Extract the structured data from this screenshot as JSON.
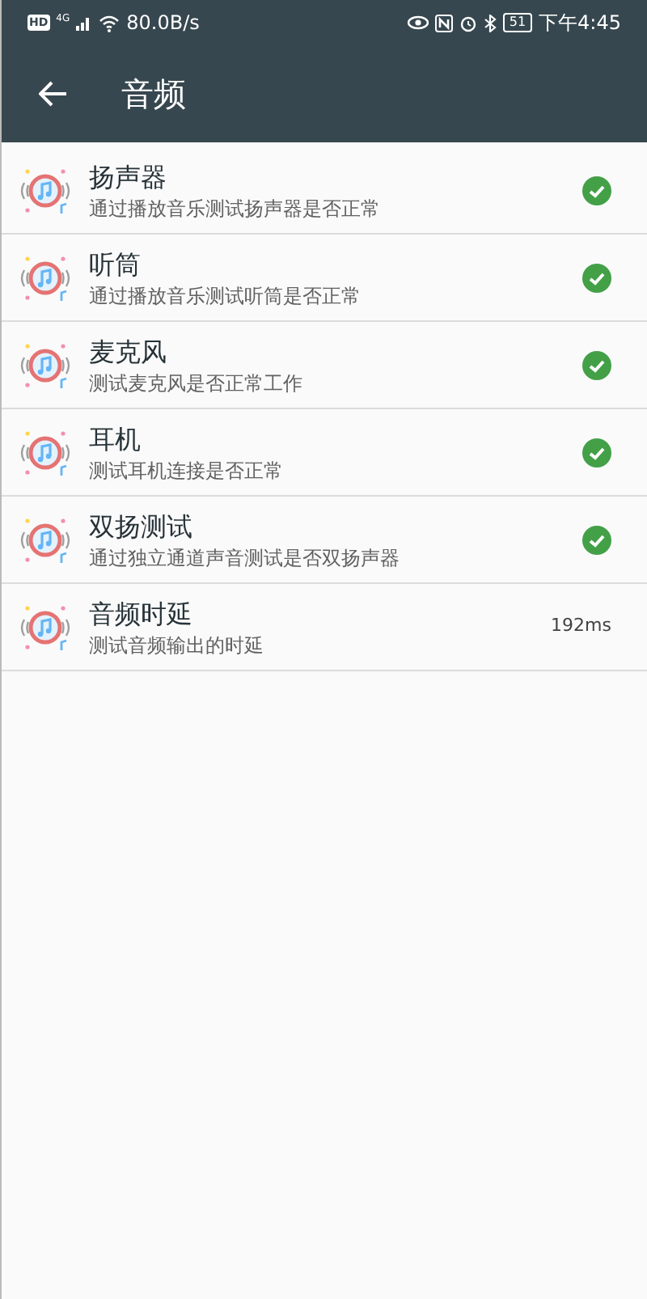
{
  "status_bar": {
    "hd": "HD",
    "network": "4G",
    "speed": "80.0B/s",
    "battery": "51",
    "time": "下午4:45"
  },
  "toolbar": {
    "title": "音频"
  },
  "tests": [
    {
      "title": "扬声器",
      "subtitle": "通过播放音乐测试扬声器是否正常",
      "kind": "status",
      "passed": true
    },
    {
      "title": "听筒",
      "subtitle": "通过播放音乐测试听筒是否正常",
      "kind": "status",
      "passed": true
    },
    {
      "title": "麦克风",
      "subtitle": "测试麦克风是否正常工作",
      "kind": "status",
      "passed": true
    },
    {
      "title": "耳机",
      "subtitle": "测试耳机连接是否正常",
      "kind": "status",
      "passed": true
    },
    {
      "title": "双扬测试",
      "subtitle": "通过独立通道声音测试是否双扬声器",
      "kind": "status",
      "passed": true
    },
    {
      "title": "音频时延",
      "subtitle": "测试音频输出的时延",
      "kind": "reading",
      "reading": "192ms"
    }
  ]
}
